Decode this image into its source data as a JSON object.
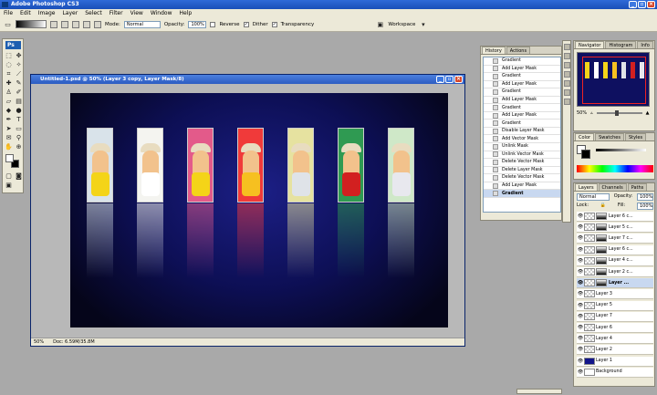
{
  "app": {
    "title": "Adobe Photoshop CS3"
  },
  "menu": [
    "File",
    "Edit",
    "Image",
    "Layer",
    "Select",
    "Filter",
    "View",
    "Window",
    "Help"
  ],
  "options": {
    "mode_label": "Mode:",
    "mode_value": "Normal",
    "opacity_label": "Opacity:",
    "opacity_value": "100%",
    "reverse_label": "Reverse",
    "dither_label": "Dither",
    "transparency_label": "Transparency",
    "workspace_label": "Workspace"
  },
  "toolbox": {
    "logo": "Ps"
  },
  "document": {
    "title": "Untitled-1.psd @ 50% (Layer 3 copy, Layer Mask/8)",
    "zoom": "50%",
    "doc_info": "Doc: 6.59M/35.8M"
  },
  "history": {
    "tabs": [
      "History",
      "Actions"
    ],
    "items": [
      "Gradient",
      "Add Layer Mask",
      "Gradient",
      "Add Layer Mask",
      "Gradient",
      "Add Layer Mask",
      "Gradient",
      "Add Layer Mask",
      "Gradient",
      "Disable Layer Mask",
      "Add Vector Mask",
      "Unlink Mask",
      "Unlink Vector Mask",
      "Delete Vector Mask",
      "Delete Layer Mask",
      "Delete Vector Mask",
      "Add Layer Mask",
      "Gradient"
    ],
    "active_index": 17
  },
  "navigator": {
    "tabs": [
      "Navigator",
      "Histogram",
      "Info"
    ],
    "zoom": "50%"
  },
  "color": {
    "tabs": [
      "Color",
      "Swatches",
      "Styles"
    ]
  },
  "layers": {
    "tabs": [
      "Layers",
      "Channels",
      "Paths"
    ],
    "blend_mode": "Normal",
    "opacity_label": "Opacity:",
    "opacity_value": "100%",
    "lock_label": "Lock:",
    "fill_label": "Fill:",
    "fill_value": "100%",
    "rows": [
      {
        "name": "Layer 6 c...",
        "mask": true
      },
      {
        "name": "Layer 5 c...",
        "mask": true
      },
      {
        "name": "Layer 7 c...",
        "mask": true
      },
      {
        "name": "Layer 6 c...",
        "mask": true
      },
      {
        "name": "Layer 4 c...",
        "mask": true
      },
      {
        "name": "Layer 2 c...",
        "mask": true
      },
      {
        "name": "Layer ...",
        "mask": true,
        "active": true
      },
      {
        "name": "Layer 3",
        "mask": false
      },
      {
        "name": "Layer 5",
        "mask": false
      },
      {
        "name": "Layer 7",
        "mask": false
      },
      {
        "name": "Layer 6",
        "mask": false
      },
      {
        "name": "Layer 4",
        "mask": false
      },
      {
        "name": "Layer 2",
        "mask": false
      },
      {
        "name": "Layer 1",
        "mask": false,
        "blue": true
      },
      {
        "name": "Background",
        "mask": false,
        "background": true
      }
    ]
  },
  "photos": [
    {
      "bg": "#d9e3ea",
      "shirt": "#f4d418"
    },
    {
      "bg": "#f4f4f0",
      "shirt": "#ffffff"
    },
    {
      "bg": "#e35a8a",
      "shirt": "#f4d418"
    },
    {
      "bg": "#f03a3a",
      "shirt": "#f6c020"
    },
    {
      "bg": "#e6e2a0",
      "shirt": "#dfe3e8"
    },
    {
      "bg": "#2f9a52",
      "shirt": "#d22020"
    },
    {
      "bg": "#cfe8c8",
      "shirt": "#e8e8ee"
    }
  ]
}
